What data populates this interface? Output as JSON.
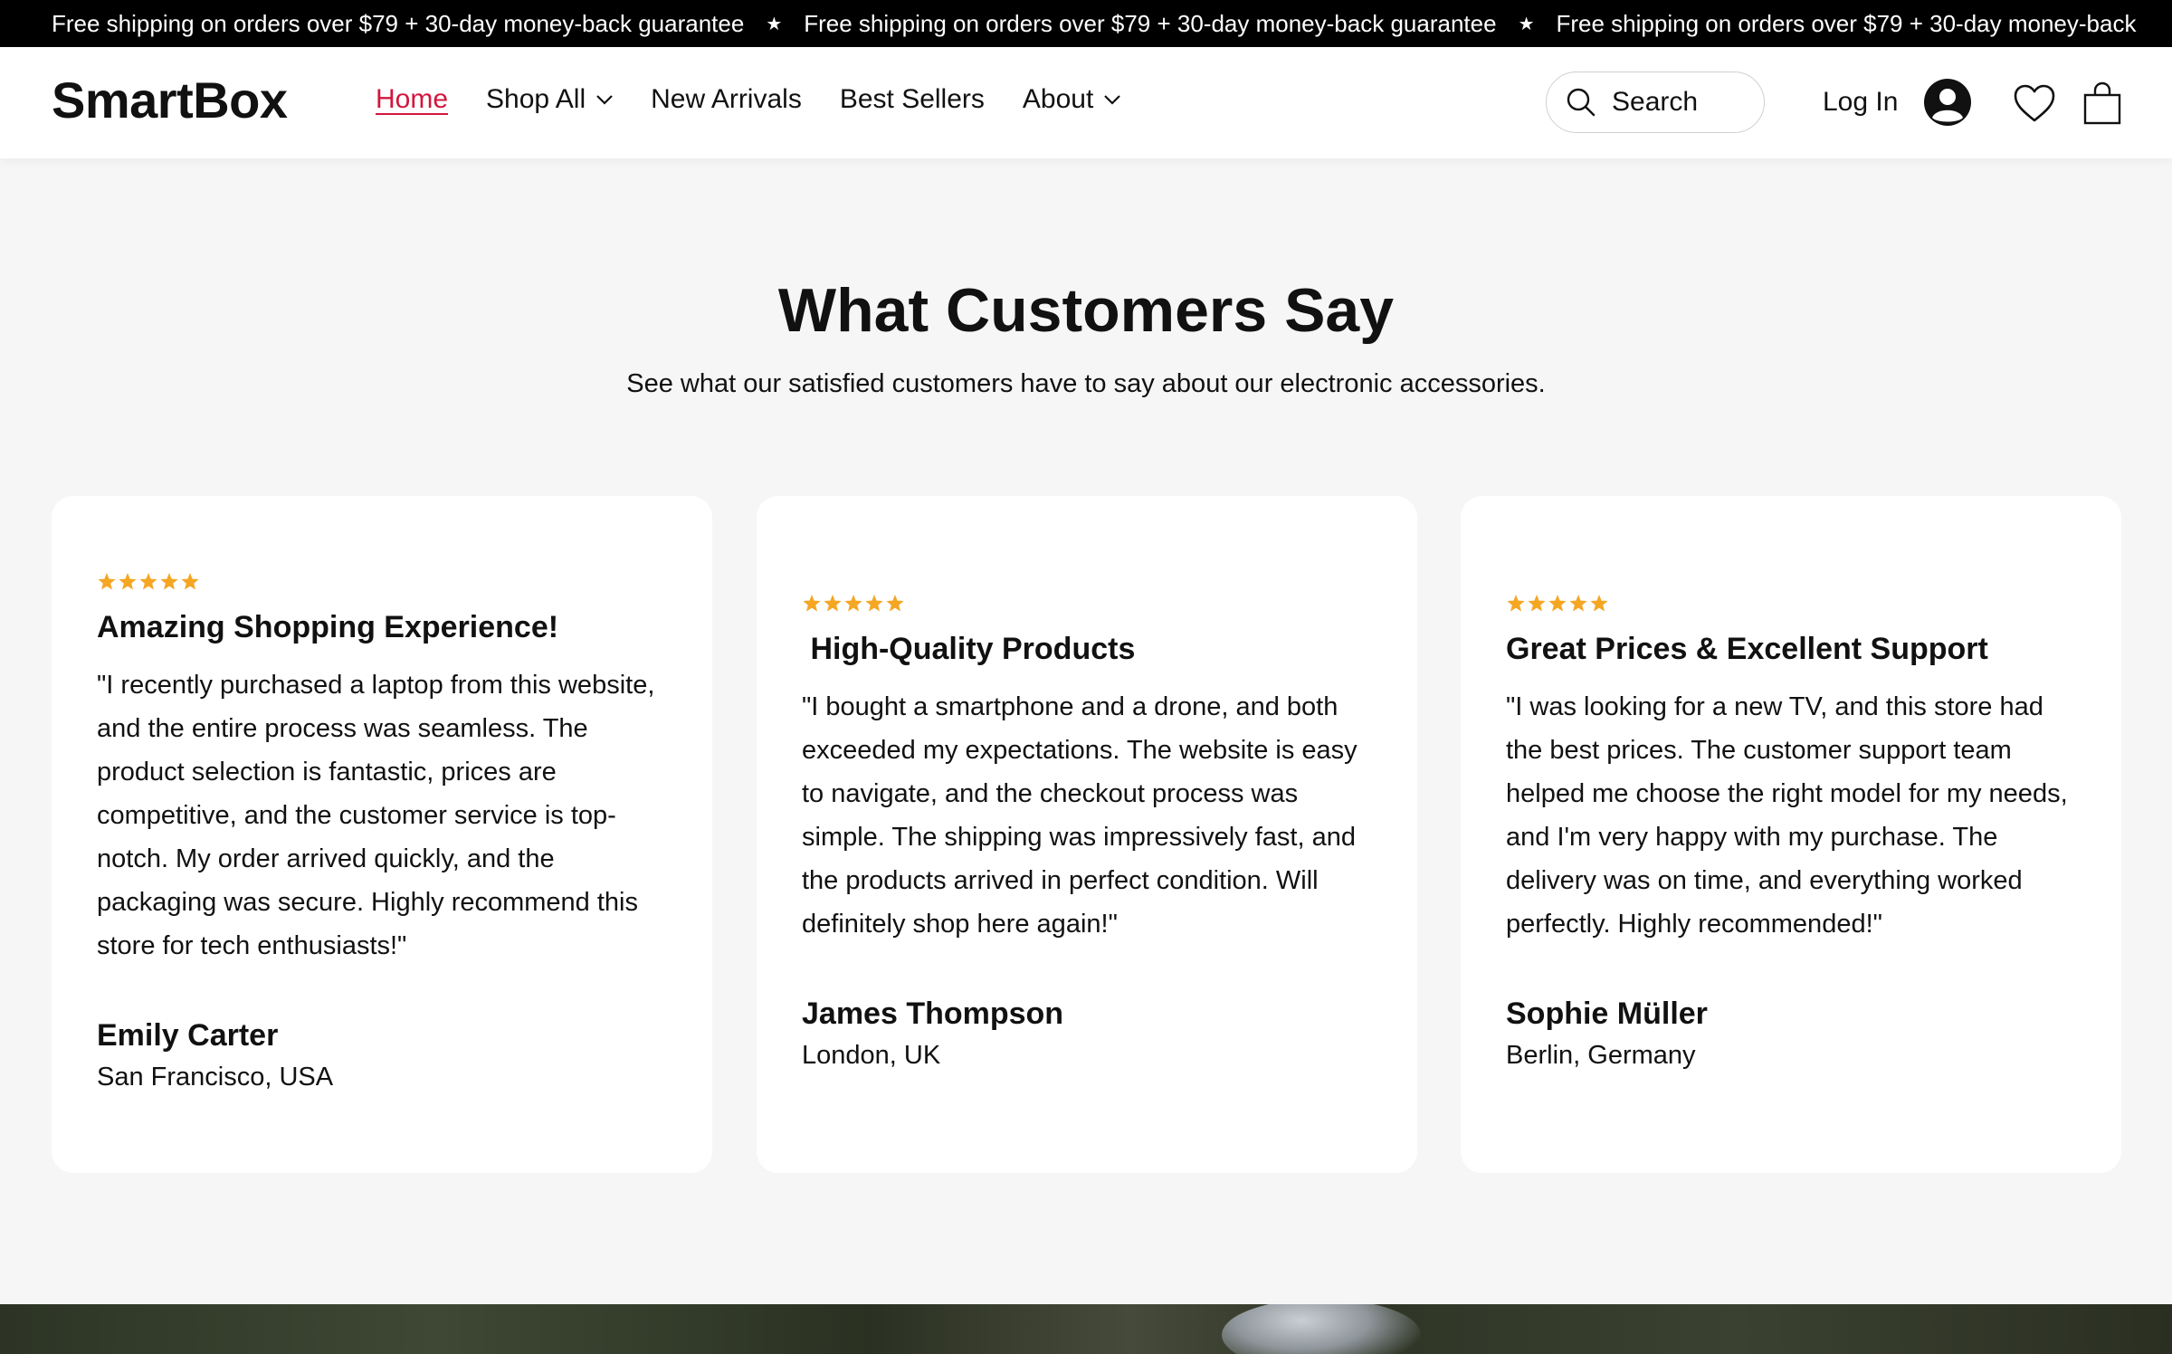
{
  "announcement": {
    "items": [
      "Free shipping on orders over $79 + 30-day money-back guarantee",
      "Free shipping on orders over $79 + 30-day money-back guarantee",
      "Free shipping on orders over $79 + 30-day money-back"
    ],
    "separator": "★"
  },
  "header": {
    "logo": "SmartBox",
    "nav": [
      {
        "label": "Home",
        "active": true,
        "dropdown": false
      },
      {
        "label": "Shop All",
        "active": false,
        "dropdown": true
      },
      {
        "label": "New Arrivals",
        "active": false,
        "dropdown": false
      },
      {
        "label": "Best Sellers",
        "active": false,
        "dropdown": false
      },
      {
        "label": "About",
        "active": false,
        "dropdown": true
      }
    ],
    "search_label": "Search",
    "login_label": "Log In",
    "accent_color": "#d3163d"
  },
  "testimonials": {
    "title": "What Customers Say",
    "subtitle": "See what our satisfied customers have to say about our electronic accessories.",
    "star_color": "#f5a623",
    "cards": [
      {
        "rating": 5,
        "title": "Amazing Shopping Experience!",
        "body": "\"I recently purchased a laptop from this website, and the entire process was seamless. The product selection is fantastic, prices are competitive, and the customer service is top-notch. My order arrived quickly, and the packaging was secure. Highly recommend this store for tech enthusiasts!\"",
        "name": "Emily Carter",
        "location": "San Francisco, USA"
      },
      {
        "rating": 5,
        "title": " High-Quality Products",
        "body": "\"I bought a smartphone and a drone, and both exceeded my expectations. The website is easy to navigate, and the checkout process was simple. The shipping was impressively fast, and the products arrived in perfect condition. Will definitely shop here again!\"",
        "name": "James Thompson",
        "location": "London, UK"
      },
      {
        "rating": 5,
        "title": "Great Prices & Excellent Support",
        "body": "\"I was looking for a new TV, and this store had the best prices. The customer support team helped me choose the right model for my needs, and I'm very happy with my purchase. The delivery was on time, and everything worked perfectly. Highly recommended!\"",
        "name": "Sophie Müller",
        "location": "Berlin, Germany"
      }
    ]
  }
}
